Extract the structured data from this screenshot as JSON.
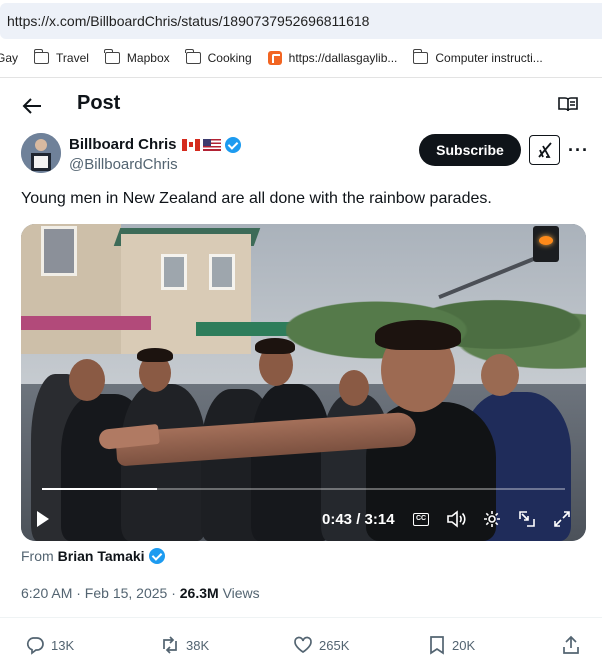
{
  "browser": {
    "url": "https://x.com/BillboardChris/status/1890737952696811618",
    "bookmarks": [
      {
        "label": "Gay",
        "icon": "folder-icon"
      },
      {
        "label": "Travel",
        "icon": "folder-icon"
      },
      {
        "label": "Mapbox",
        "icon": "folder-icon"
      },
      {
        "label": "Cooking",
        "icon": "folder-icon"
      },
      {
        "label": "https://dallasgaylib...",
        "icon": "rss-icon"
      },
      {
        "label": "Computer instructi...",
        "icon": "folder-icon"
      }
    ]
  },
  "header": {
    "title": "Post"
  },
  "author": {
    "name": "Billboard Chris",
    "handle": "@BillboardChris",
    "flags": [
      "canada-flag",
      "usa-flag"
    ],
    "verified": true
  },
  "buttons": {
    "subscribe": "Subscribe",
    "more": "···"
  },
  "tweet": {
    "text": "Young men in New Zealand are all done with the rainbow parades."
  },
  "video": {
    "time": "0:43 / 3:14",
    "progress_fraction": 0.22,
    "controls": [
      "play-icon",
      "captions-icon",
      "volume-icon",
      "settings-icon",
      "pip-icon",
      "fullscreen-icon"
    ]
  },
  "source": {
    "prefix": "From",
    "name": "Brian Tamaki"
  },
  "meta": {
    "timestamp": "6:20 AM · Feb 15, 2025 · ",
    "views": "26.3M",
    "views_label": " Views"
  },
  "actions": {
    "replies": "13K",
    "reposts": "38K",
    "likes": "265K",
    "bookmarks": "20K"
  },
  "colors": {
    "accent": "#1d9bf0",
    "text": "#0f1419",
    "secondary": "#536471"
  }
}
